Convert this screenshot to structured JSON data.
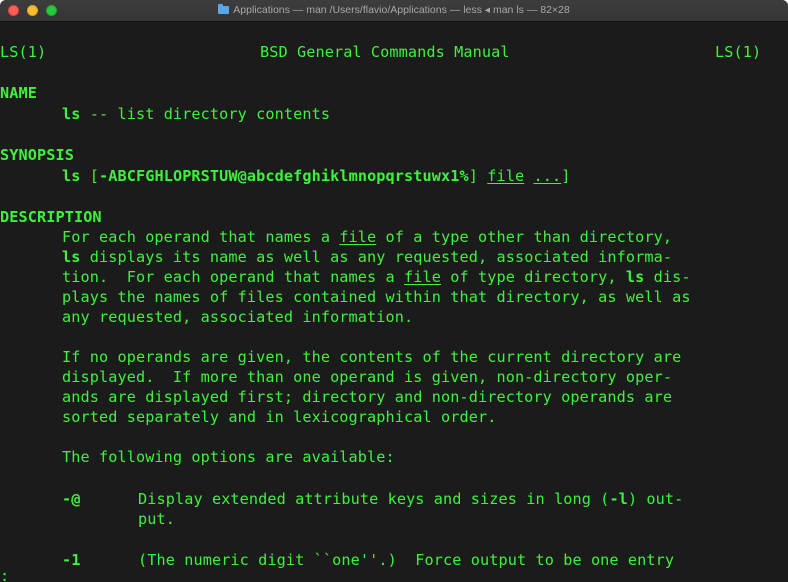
{
  "window": {
    "title": "Applications — man /Users/flavio/Applications — less ◂ man ls — 82×28"
  },
  "header": {
    "left": "LS(1)",
    "center": "BSD General Commands Manual",
    "right": "LS(1)"
  },
  "sections": {
    "name_heading": "NAME",
    "name_cmd": "ls",
    "name_desc": " -- list directory contents",
    "synopsis_heading": "SYNOPSIS",
    "synopsis_cmd": "ls",
    "synopsis_bracket_open": " [",
    "synopsis_flags": "-ABCFGHLOPRSTUW@abcdefghiklmnopqrstuwx1%",
    "synopsis_bracket_close": "] ",
    "synopsis_file": "file",
    "synopsis_space": " ",
    "synopsis_ellipsis": "...",
    "synopsis_end": "]",
    "description_heading": "DESCRIPTION"
  },
  "description": {
    "p1_l1_a": "For each operand that names a ",
    "p1_l1_file": "file",
    "p1_l1_b": " of a type other than directory,",
    "p1_l2_ls": "ls",
    "p1_l2_b": " displays its name as well as any requested, associated informa-",
    "p1_l3_a": "tion.  For each operand that names a ",
    "p1_l3_file": "file",
    "p1_l3_b": " of type directory, ",
    "p1_l3_ls": "ls",
    "p1_l3_c": " dis-",
    "p1_l4": "plays the names of files contained within that directory, as well as",
    "p1_l5": "any requested, associated information.",
    "p2_l1": "If no operands are given, the contents of the current directory are",
    "p2_l2": "displayed.  If more than one operand is given, non-directory oper-",
    "p2_l3": "ands are displayed first; directory and non-directory operands are",
    "p2_l4": "sorted separately and in lexicographical order.",
    "p3_l1": "The following options are available:"
  },
  "options": [
    {
      "flag": "-@",
      "desc_a": "Display extended attribute keys and sizes in long (",
      "desc_flag": "-l",
      "desc_b": ") out-",
      "desc_cont": "put."
    },
    {
      "flag": "-1",
      "desc": "(The numeric digit ``one''.)  Force output to be one entry"
    }
  ],
  "prompt": ":",
  "colors": {
    "terminal_bg": "#1b1b1b",
    "terminal_fg": "#3cf33c",
    "titlebar_bg": "#383838"
  }
}
